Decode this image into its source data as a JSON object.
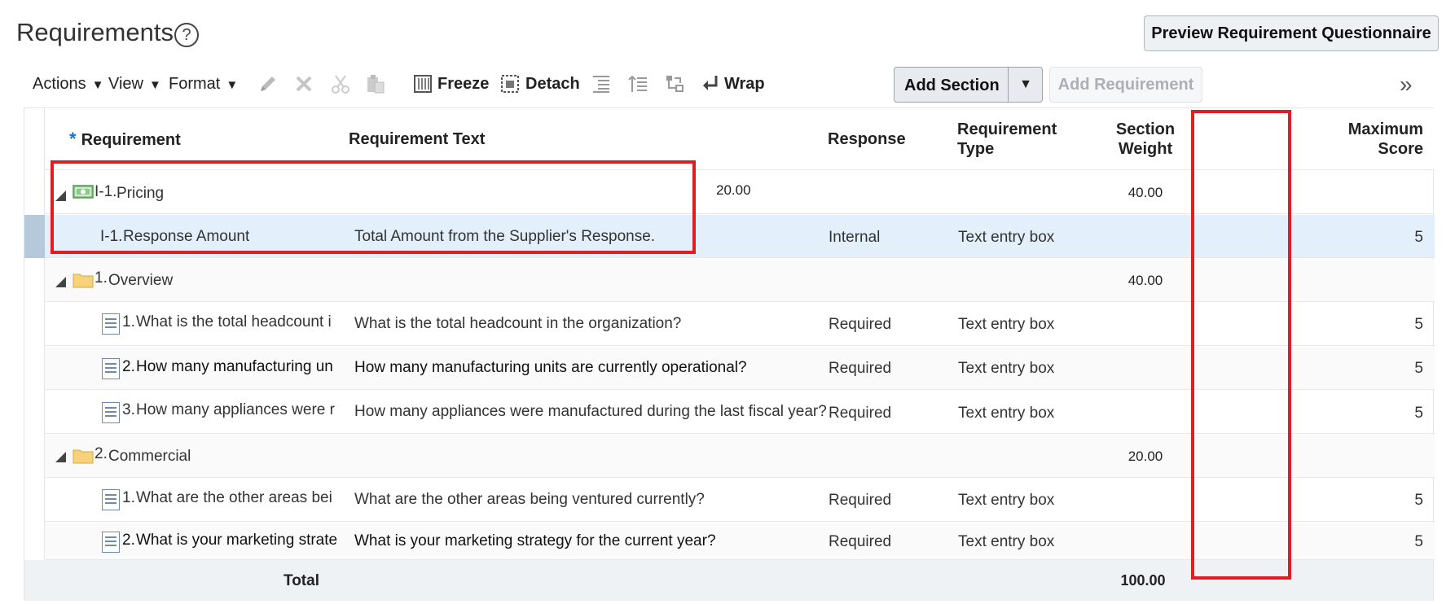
{
  "page": {
    "title": "Requirements",
    "help": "?"
  },
  "preview_button": "Preview Requirement Questionnaire",
  "toolbar": {
    "actions": "Actions",
    "view": "View",
    "format": "Format",
    "freeze": "Freeze",
    "detach": "Detach",
    "wrap": "Wrap",
    "add_section": "Add Section",
    "add_requirement": "Add Requirement",
    "more": "»"
  },
  "columns": {
    "requirement": "Requirement",
    "requirement_text": "Requirement Text",
    "response": "Response",
    "requirement_type_1": "Requirement",
    "requirement_type_2": "Type",
    "section_weight_1": "Section",
    "section_weight_2": "Weight",
    "maximum_score_1": "Maximum",
    "maximum_score_2": "Score"
  },
  "sections": [
    {
      "number": "I-1.",
      "name": "Pricing",
      "extra_value": "20.00",
      "weight": "40.00",
      "icon": "money-icon",
      "rows": [
        {
          "number": "I-1.",
          "name": "Response Amount",
          "text": "Total Amount from the Supplier's Response.",
          "response": "Internal",
          "type": "Text entry box",
          "max_score": "5"
        }
      ]
    },
    {
      "number": "1.",
      "name": "Overview",
      "weight": "40.00",
      "icon": "folder-icon",
      "rows": [
        {
          "number": "1.",
          "name": "What is the total headcount i",
          "text": "What is the total headcount in the organization?",
          "response": "Required",
          "type": "Text entry box",
          "max_score": "5"
        },
        {
          "number": "2.",
          "name": "How many manufacturing un",
          "text": "How many manufacturing units are currently operational?",
          "response": "Required",
          "type": "Text entry box",
          "max_score": "5"
        },
        {
          "number": "3.",
          "name": "How many appliances were r",
          "text": "How many appliances were manufactured during the last fiscal year?",
          "response": "Required",
          "type": "Text entry box",
          "max_score": "5"
        }
      ]
    },
    {
      "number": "2.",
      "name": "Commercial",
      "weight": "20.00",
      "icon": "folder-icon",
      "rows": [
        {
          "number": "1.",
          "name": "What are the other areas bei",
          "text": "What are the other areas being ventured currently?",
          "response": "Required",
          "type": "Text entry box",
          "max_score": "5"
        },
        {
          "number": "2.",
          "name": "What is your marketing strate",
          "text": "What is your marketing strategy for the current year?",
          "response": "Required",
          "type": "Text entry box",
          "max_score": "5"
        }
      ]
    }
  ],
  "total": {
    "label": "Total",
    "weight": "100.00"
  },
  "colors": {
    "highlight": "#e01c24",
    "selected_row": "#e3f0fb",
    "accent": "#1f6fd0"
  }
}
